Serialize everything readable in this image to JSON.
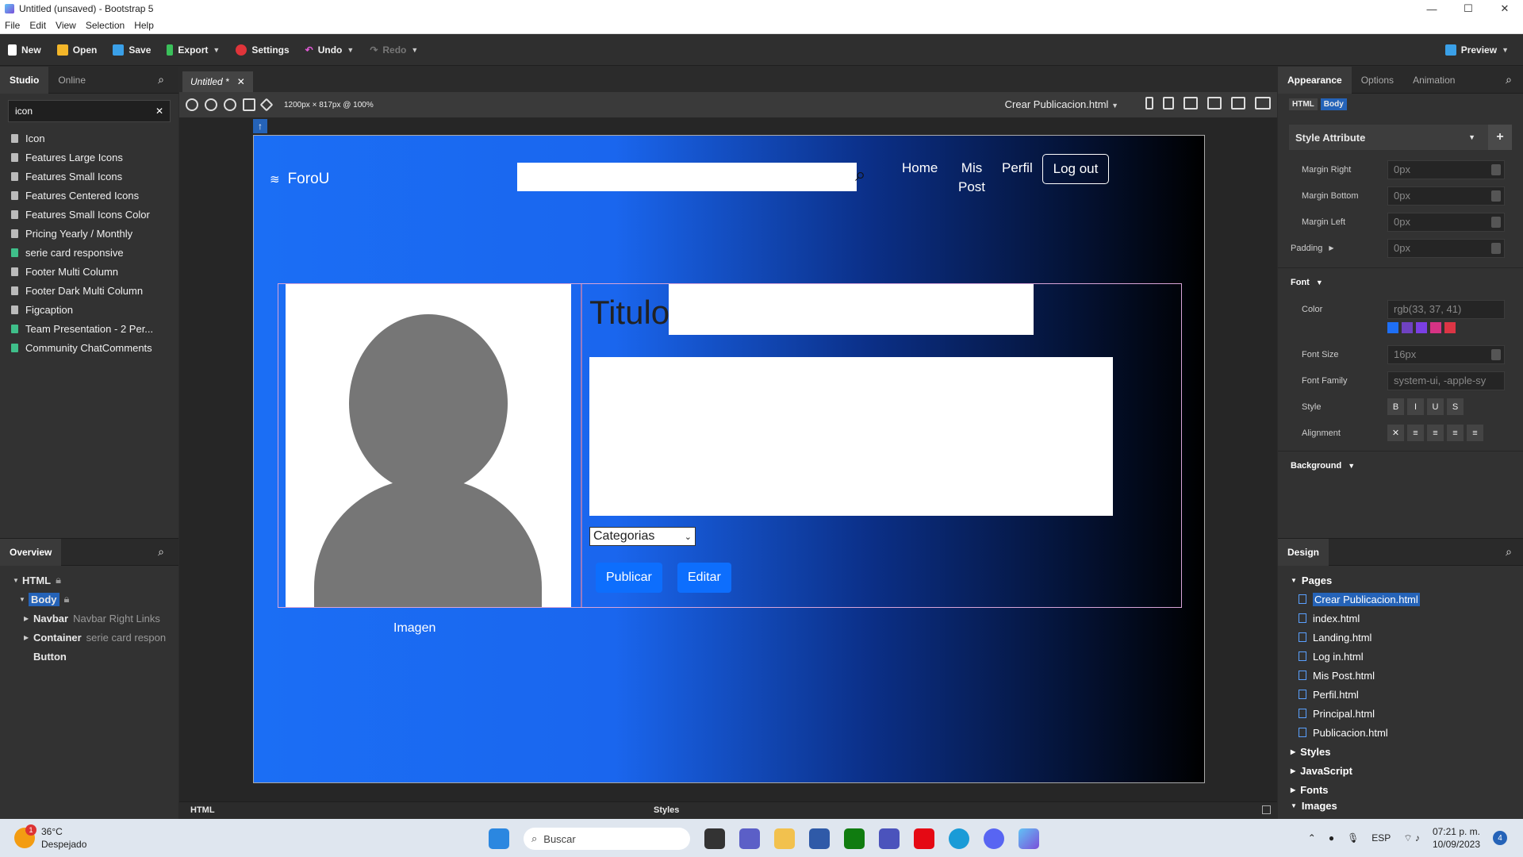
{
  "window": {
    "title": "Untitled (unsaved) - Bootstrap 5",
    "controls": [
      "—",
      "☐",
      "✕"
    ]
  },
  "menu": [
    "File",
    "Edit",
    "View",
    "Selection",
    "Help"
  ],
  "toolbar": {
    "new": "New",
    "open": "Open",
    "save": "Save",
    "export": "Export",
    "settings": "Settings",
    "undo": "Undo",
    "redo": "Redo",
    "preview": "Preview"
  },
  "left": {
    "tabs": [
      "Studio",
      "Online"
    ],
    "search_value": "icon",
    "components": [
      {
        "label": "Icon",
        "color": "gray"
      },
      {
        "label": "Features Large Icons",
        "color": "gray"
      },
      {
        "label": "Features Small Icons",
        "color": "gray"
      },
      {
        "label": "Features Centered Icons",
        "color": "gray"
      },
      {
        "label": "Features Small Icons Color",
        "color": "gray"
      },
      {
        "label": "Pricing Yearly / Monthly",
        "color": "gray"
      },
      {
        "label": "serie card responsive",
        "color": "green"
      },
      {
        "label": "Footer Multi Column",
        "color": "gray"
      },
      {
        "label": "Footer Dark Multi Column",
        "color": "gray"
      },
      {
        "label": "Figcaption",
        "color": "gray"
      },
      {
        "label": "Team Presentation - 2 Per...",
        "color": "green"
      },
      {
        "label": "Community ChatComments",
        "color": "green"
      }
    ],
    "overview_title": "Overview",
    "tree": [
      {
        "label": "HTML",
        "extra": "",
        "indent": 0,
        "arrow": "▾"
      },
      {
        "label": "Body",
        "extra": "",
        "indent": 1,
        "arrow": "▾"
      },
      {
        "label": "Navbar",
        "extra": "Navbar Right Links",
        "indent": 2,
        "arrow": "▸"
      },
      {
        "label": "Container",
        "extra": "serie card respons",
        "indent": 2,
        "arrow": "▸"
      },
      {
        "label": "Button",
        "extra": "",
        "indent": 2,
        "arrow": ""
      }
    ]
  },
  "doc": {
    "tab": "Untitled *",
    "size_info": "1200px × 817px @ 100%",
    "page_select": "Crear Publicacion.html"
  },
  "stage": {
    "brand": "ForoU",
    "nav": {
      "home": "Home",
      "mis": "Mis",
      "post": "Post",
      "perfil": "Perfil",
      "logout": "Log out"
    },
    "titulo": "Titulo:",
    "select": "Categorias",
    "publicar": "Publicar",
    "editar": "Editar",
    "imagen": "Imagen"
  },
  "bottom": {
    "html": "HTML",
    "styles": "Styles"
  },
  "right": {
    "tabs": [
      "Appearance",
      "Options",
      "Animation"
    ],
    "chips": [
      "HTML",
      "Body"
    ],
    "style_attr": "Style Attribute",
    "props": [
      {
        "label": "Margin Right",
        "value": "0px"
      },
      {
        "label": "Margin Bottom",
        "value": "0px"
      },
      {
        "label": "Margin Left",
        "value": "0px"
      },
      {
        "label": "Padding",
        "value": "0px"
      }
    ],
    "font": "Font",
    "color_label": "Color",
    "color_value": "rgb(33, 37, 41)",
    "swatches": [
      "#1e6ff5",
      "#6f42c1",
      "#7b3fe4",
      "#d63384",
      "#dc3545"
    ],
    "font_size_label": "Font Size",
    "font_size": "16px",
    "font_family_label": "Font Family",
    "font_family": "system-ui, -apple-sy",
    "style_label": "Style",
    "style_btns": [
      "B",
      "I",
      "U",
      "S"
    ],
    "alignment_label": "Alignment",
    "background": "Background",
    "design": "Design",
    "pages_title": "Pages",
    "pages": [
      "Crear Publicacion.html",
      "index.html",
      "Landing.html",
      "Log in.html",
      "Mis Post.html",
      "Perfil.html",
      "Principal.html",
      "Publicacion.html"
    ],
    "sections": [
      "Styles",
      "JavaScript",
      "Fonts",
      "Images"
    ]
  },
  "taskbar": {
    "temp": "36°C",
    "weather": "Despejado",
    "badge": "1",
    "search": "Buscar",
    "lang": "ESP",
    "time": "07:21 p. m.",
    "date": "10/09/2023",
    "notif": "4"
  }
}
